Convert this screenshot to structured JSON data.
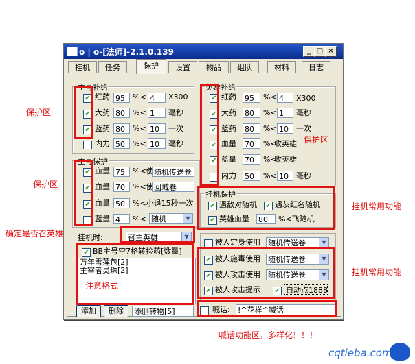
{
  "window": {
    "title": "o | o-[法师]-2.1.0.139"
  },
  "tabs": [
    {
      "label": "挂机"
    },
    {
      "label": "任务"
    },
    {
      "label": "保护",
      "active": true
    },
    {
      "label": "设置"
    },
    {
      "label": "物品"
    },
    {
      "label": "组队"
    },
    {
      "label": "材料"
    },
    {
      "label": "日志"
    }
  ],
  "main_supply": {
    "title": "主号补给",
    "rows": [
      {
        "label": "红药",
        "checked": true,
        "pct": "95",
        "sym": "%<",
        "val": "4",
        "unit": "X300"
      },
      {
        "label": "大药",
        "checked": true,
        "pct": "80",
        "sym": "%<",
        "val": "1",
        "unit": "毫秒"
      },
      {
        "label": "蓝药",
        "checked": true,
        "pct": "80",
        "sym": "%<",
        "val": "10",
        "unit": "一次"
      },
      {
        "label": "内力",
        "checked": false,
        "pct": "50",
        "sym": "%<",
        "val": "10",
        "unit": "毫秒"
      }
    ]
  },
  "main_protect": {
    "title": "主号保护",
    "rows": [
      {
        "label": "血量",
        "checked": true,
        "pct": "75",
        "sym": "%<使",
        "value": "随机传送卷"
      },
      {
        "label": "血量",
        "checked": true,
        "pct": "70",
        "sym": "%<使",
        "value": "回城卷"
      },
      {
        "label": "血量",
        "checked": true,
        "pct": "50",
        "sym": "%<小退15秒一次",
        "value": ""
      },
      {
        "label": "蓝量",
        "checked": false,
        "pct": "4",
        "sym": "%<",
        "value": "随机"
      }
    ]
  },
  "hook_time": {
    "label": "挂机时:",
    "value": "召主英雄"
  },
  "bb_section": {
    "checkbox_label": "BB主号空7格转捡药[数量]",
    "checked": true,
    "list": [
      "万年雪莲包[2]",
      "主宰者灵珠[2]"
    ]
  },
  "bottom_buttons": {
    "add": "添加",
    "delete": "删除",
    "transfer_input": "添删转物[5]"
  },
  "hero_supply": {
    "title": "英雄补给",
    "rows": [
      {
        "label": "红药",
        "checked": true,
        "pct": "95",
        "sym": "%<",
        "val": "4",
        "unit": "X300"
      },
      {
        "label": "大药",
        "checked": true,
        "pct": "80",
        "sym": "%<",
        "val": "1",
        "unit": "毫秒"
      },
      {
        "label": "蓝药",
        "checked": true,
        "pct": "80",
        "sym": "%<",
        "val": "10",
        "unit": "一次"
      },
      {
        "label": "血量",
        "checked": true,
        "pct": "70",
        "sym": "%<",
        "unit": "收英雄"
      },
      {
        "label": "蓝量",
        "checked": true,
        "pct": "70",
        "sym": "%<",
        "unit": "收英雄"
      },
      {
        "label": "内力",
        "checked": false,
        "pct": "50",
        "sym": "%<",
        "val": "10",
        "unit": "毫秒"
      }
    ]
  },
  "hook_protect": {
    "title": "挂机保护",
    "opt1": "遇敌对随机",
    "opt2": "遇灰红名随机",
    "opt3": "英雄血量",
    "opt3_val": "80",
    "opt3_suffix": "%<飞随机"
  },
  "passive": {
    "rows": [
      {
        "label": "被人定身使用",
        "checked": false,
        "value": "随机传送卷"
      },
      {
        "label": "被人施毒使用",
        "checked": true,
        "value": "随机传送卷"
      },
      {
        "label": "被人攻击使用",
        "checked": true,
        "value": "随机传送卷"
      }
    ],
    "attack_hint": "被人攻击提示",
    "auto_point": "自动点1888"
  },
  "shout": {
    "label": "喊话:",
    "value": "!^花样^喊话"
  },
  "notes": {
    "protect1": "保护区",
    "protect2": "保护区",
    "hero_confirm": "确定是否召英雄",
    "format_note": "注意格式",
    "protect3": "保护区",
    "hook_func1": "挂机常用功能",
    "hook_func2": "挂机常用功能",
    "shout_note": "喊话功能区，多样化！！！"
  },
  "watermark": "cqtieba.com"
}
